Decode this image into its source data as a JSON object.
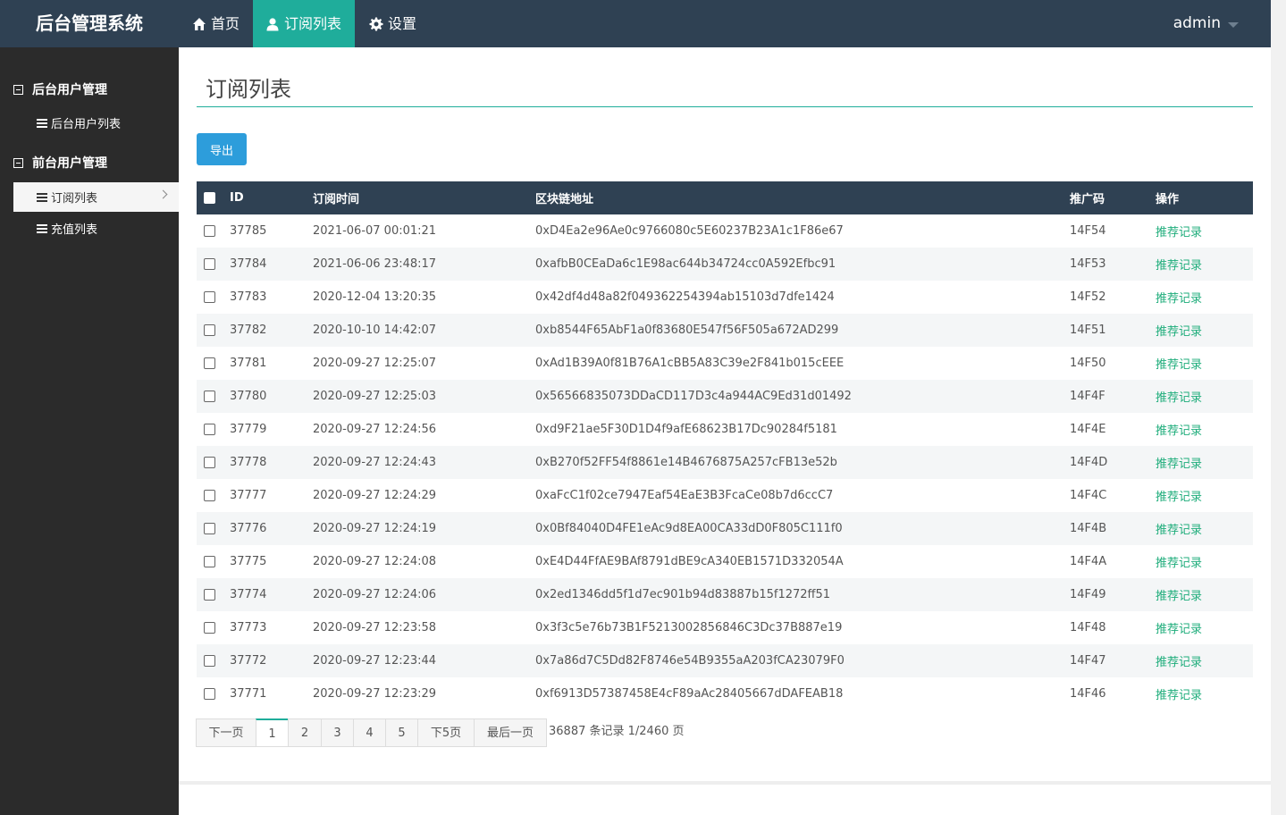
{
  "app": {
    "title": "后台管理系统"
  },
  "nav": [
    {
      "label": "首页",
      "icon": "home-icon"
    },
    {
      "label": "订阅列表",
      "icon": "user-icon"
    },
    {
      "label": "设置",
      "icon": "gear-icon"
    }
  ],
  "user": {
    "name": "admin"
  },
  "sidebar": {
    "groups": [
      {
        "label": "后台用户管理",
        "items": [
          {
            "label": "后台用户列表"
          }
        ]
      },
      {
        "label": "前台用户管理",
        "items": [
          {
            "label": "订阅列表"
          },
          {
            "label": "充值列表"
          }
        ]
      }
    ]
  },
  "page": {
    "title": "订阅列表",
    "export_label": "导出"
  },
  "table": {
    "headers": [
      "ID",
      "订阅时间",
      "区块链地址",
      "推广码",
      "操作"
    ],
    "rows": [
      [
        "37785",
        "2021-06-07 00:01:21",
        "0xD4Ea2e96Ae0c9766080c5E60237B23A1c1F86e67",
        "14F54",
        "推荐记录"
      ],
      [
        "37784",
        "2021-06-06 23:48:17",
        "0xafbB0CEaDa6c1E98ac644b34724cc0A592Efbc91",
        "14F53",
        "推荐记录"
      ],
      [
        "37783",
        "2020-12-04 13:20:35",
        "0x42df4d48a82f049362254394ab15103d7dfe1424",
        "14F52",
        "推荐记录"
      ],
      [
        "37782",
        "2020-10-10 14:42:07",
        "0xb8544F65AbF1a0f83680E547f56F505a672AD299",
        "14F51",
        "推荐记录"
      ],
      [
        "37781",
        "2020-09-27 12:25:07",
        "0xAd1B39A0f81B76A1cBB5A83C39e2F841b015cEEE",
        "14F50",
        "推荐记录"
      ],
      [
        "37780",
        "2020-09-27 12:25:03",
        "0x56566835073DDaCD117D3c4a944AC9Ed31d01492",
        "14F4F",
        "推荐记录"
      ],
      [
        "37779",
        "2020-09-27 12:24:56",
        "0xd9F21ae5F30D1D4f9afE68623B17Dc90284f5181",
        "14F4E",
        "推荐记录"
      ],
      [
        "37778",
        "2020-09-27 12:24:43",
        "0xB270f52FF54f8861e14B4676875A257cFB13e52b",
        "14F4D",
        "推荐记录"
      ],
      [
        "37777",
        "2020-09-27 12:24:29",
        "0xaFcC1f02ce7947Eaf54EaE3B3FcaCe08b7d6ccC7",
        "14F4C",
        "推荐记录"
      ],
      [
        "37776",
        "2020-09-27 12:24:19",
        "0x0Bf84040D4FE1eAc9d8EA00CA33dD0F805C111f0",
        "14F4B",
        "推荐记录"
      ],
      [
        "37775",
        "2020-09-27 12:24:08",
        "0xE4D44FfAE9BAf8791dBE9cA340EB1571D332054A",
        "14F4A",
        "推荐记录"
      ],
      [
        "37774",
        "2020-09-27 12:24:06",
        "0x2ed1346dd5f1d7ec901b94d83887b15f1272ff51",
        "14F49",
        "推荐记录"
      ],
      [
        "37773",
        "2020-09-27 12:23:58",
        "0x3f3c5e76b73B1F5213002856846C3Dc37B887e19",
        "14F48",
        "推荐记录"
      ],
      [
        "37772",
        "2020-09-27 12:23:44",
        "0x7a86d7C5Dd82F8746e54B9355aA203fCA23079F0",
        "14F47",
        "推荐记录"
      ],
      [
        "37771",
        "2020-09-27 12:23:29",
        "0xf6913D57387458E4cF89aAc28405667dDAFEAB18",
        "14F46",
        "推荐记录"
      ]
    ]
  },
  "pagination": {
    "buttons": [
      "下一页",
      "1",
      "2",
      "3",
      "4",
      "5",
      "下5页",
      "最后一页"
    ],
    "current": "1",
    "summary": "36887 条记录 1/2460 页"
  },
  "colors": {
    "nav_bg": "#2f4153",
    "accent": "#1fad9b",
    "export": "#2d9ddb",
    "sidebar_bg": "#2b2b2b",
    "link": "#1fad7b"
  }
}
